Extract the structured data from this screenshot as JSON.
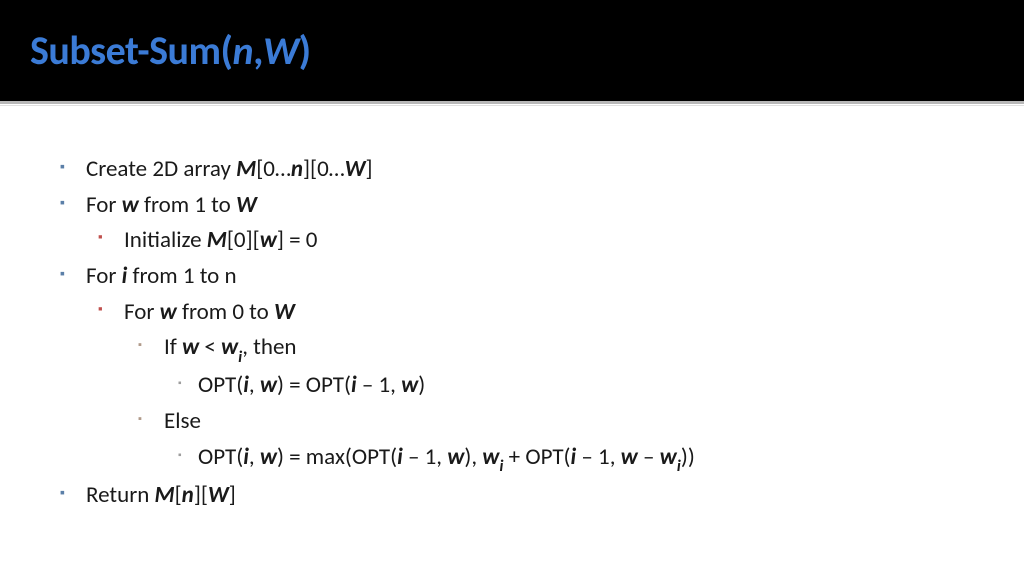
{
  "title": {
    "prefix": "Subset-Sum(",
    "arg1": "n",
    "sep": ",",
    "arg2": "W",
    "suffix": ")"
  },
  "lines": {
    "l1_pre": "Create 2D array ",
    "l1_M": "M",
    "l1_b1": "[0…",
    "l1_n": "n",
    "l1_b2": "][0…",
    "l1_W": "W",
    "l1_b3": "]",
    "l2_pre": "For ",
    "l2_w": "w",
    "l2_mid": " from 1 to ",
    "l2_W": "W",
    "l3_pre": "Initialize ",
    "l3_M": "M",
    "l3_mid1": "[0][",
    "l3_w": "w",
    "l3_mid2": "] = 0",
    "l4_pre": "For ",
    "l4_i": "i",
    "l4_mid": " from 1 to n",
    "l5_pre": "For ",
    "l5_w": "w",
    "l5_mid": " from 0 to ",
    "l5_W": "W",
    "l6_pre": "If ",
    "l6_w": "w",
    "l6_lt": " < ",
    "l6_wi": "w",
    "l6_sub": "i",
    "l6_post": ", then",
    "l7_pre": "OPT(",
    "l7_i": "i",
    "l7_c1": ", ",
    "l7_w": "w",
    "l7_mid": ") = OPT(",
    "l7_i2": "i",
    "l7_m1": " – 1, ",
    "l7_w2": "w",
    "l7_end": ")",
    "l8": "Else",
    "l9_pre": "OPT(",
    "l9_i": "i",
    "l9_c1": ", ",
    "l9_w": "w",
    "l9_mid": ") = max(OPT(",
    "l9_i2": "i",
    "l9_m1": " – 1, ",
    "l9_w2": "w",
    "l9_c2": "), ",
    "l9_wi": "w",
    "l9_sub1": "i",
    "l9_plus": " + OPT(",
    "l9_i3": "i",
    "l9_m2": " – 1, ",
    "l9_w3": "w",
    "l9_minus": " – ",
    "l9_wi2": "w",
    "l9_sub2": "i",
    "l9_end": "))",
    "l10_pre": "Return ",
    "l10_M": "M",
    "l10_b1": "[",
    "l10_n": "n",
    "l10_b2": "][",
    "l10_W": "W",
    "l10_b3": "]"
  }
}
